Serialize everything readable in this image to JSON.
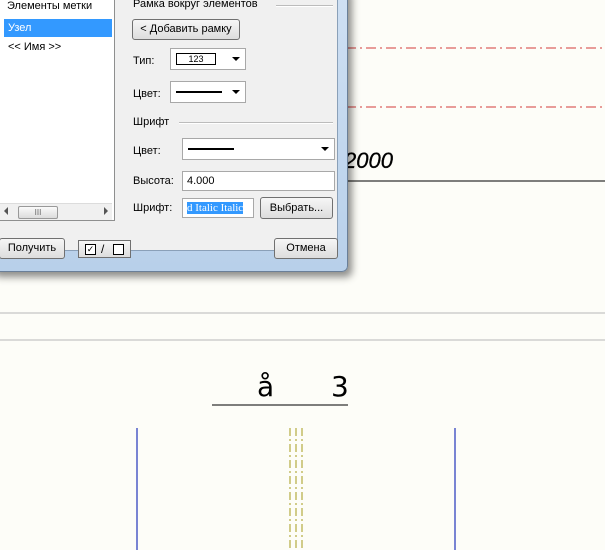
{
  "dialog": {
    "left_panel_title": "Элементы метки",
    "items": [
      "Узел",
      "<< Имя >>"
    ],
    "scroll_thumb": "III",
    "frame_title": "Рамка вокруг элементов",
    "add_frame_button": "< Добавить рамку",
    "type_label": "Тип:",
    "type_value": "123",
    "color_label": "Цвет:",
    "font_section_label": "Шрифт",
    "font_color_label": "Цвет:",
    "height_label": "Высота:",
    "height_value": "4.000",
    "font_label": "Шрифт:",
    "font_value": "d Italic Italic",
    "choose_button": "Выбрать...",
    "get_button": "Получить",
    "toggle_label": "/",
    "cancel_button": "Отмена"
  },
  "drawing": {
    "text_2000": "2000",
    "text_a": "å",
    "text_3": "3",
    "colors": {
      "red_dashdot": "#d23a3a",
      "blue": "#2233bb",
      "olive": "#a59a1a"
    }
  }
}
